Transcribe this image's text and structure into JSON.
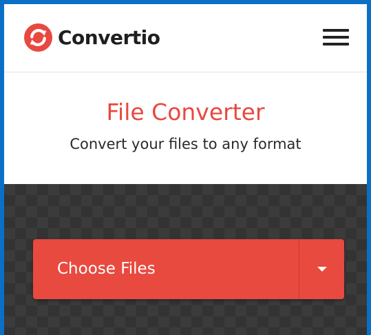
{
  "brand": {
    "name": "Convertio",
    "accent_color": "#e8483f",
    "logo_icon": "refresh-arrows-icon"
  },
  "header": {
    "menu_icon": "hamburger-menu-icon"
  },
  "hero": {
    "title": "File Converter",
    "subtitle": "Convert your files to any format"
  },
  "upload": {
    "choose_files_label": "Choose Files",
    "dropdown_icon": "caret-down-icon"
  },
  "colors": {
    "frame_border": "#0b6fc6",
    "upload_background": "#3b3b3b",
    "button": "#e84a3f"
  }
}
